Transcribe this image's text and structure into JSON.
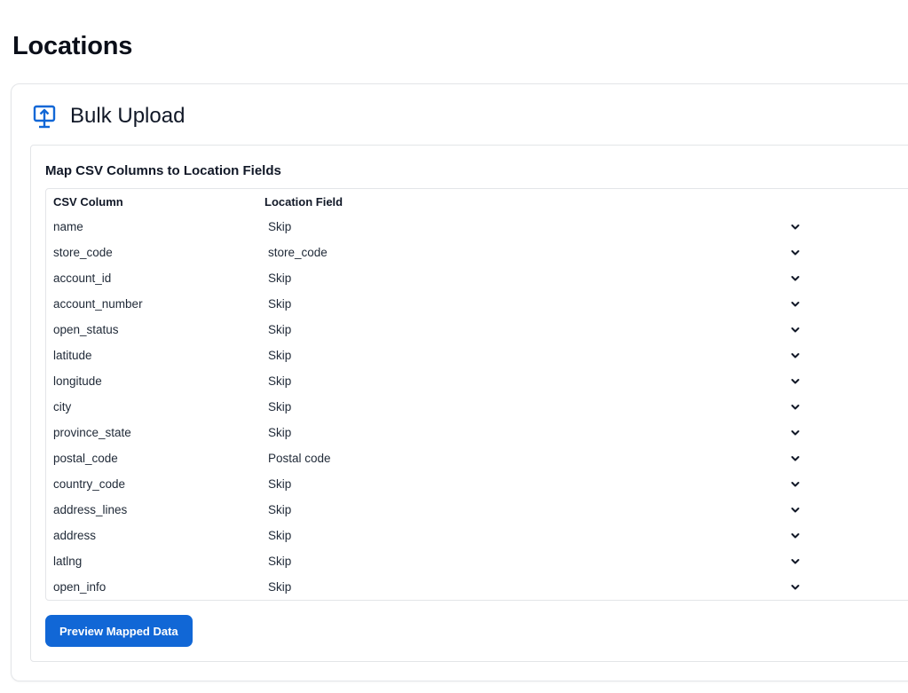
{
  "page": {
    "title": "Locations"
  },
  "card": {
    "title": "Bulk Upload",
    "icon": "upload-icon"
  },
  "mapping": {
    "title": "Map CSV Columns to Location Fields",
    "headers": {
      "csv_column": "CSV Column",
      "location_field": "Location Field"
    },
    "rows": [
      {
        "column": "name",
        "field": "Skip"
      },
      {
        "column": "store_code",
        "field": "store_code"
      },
      {
        "column": "account_id",
        "field": "Skip"
      },
      {
        "column": "account_number",
        "field": "Skip"
      },
      {
        "column": "open_status",
        "field": "Skip"
      },
      {
        "column": "latitude",
        "field": "Skip"
      },
      {
        "column": "longitude",
        "field": "Skip"
      },
      {
        "column": "city",
        "field": "Skip"
      },
      {
        "column": "province_state",
        "field": "Skip"
      },
      {
        "column": "postal_code",
        "field": "Postal code"
      },
      {
        "column": "country_code",
        "field": "Skip"
      },
      {
        "column": "address_lines",
        "field": "Skip"
      },
      {
        "column": "address",
        "field": "Skip"
      },
      {
        "column": "latlng",
        "field": "Skip"
      },
      {
        "column": "open_info",
        "field": "Skip"
      }
    ]
  },
  "actions": {
    "preview_label": "Preview Mapped Data"
  },
  "colors": {
    "accent": "#1167d6",
    "border": "#e3e5e8",
    "text": "#111827"
  }
}
